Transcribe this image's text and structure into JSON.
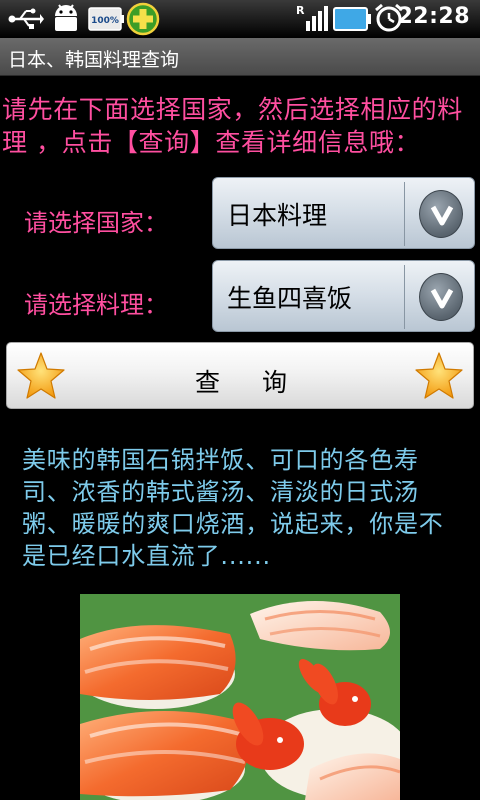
{
  "status_bar": {
    "battery_badge": "100%",
    "time": "22:28",
    "icons": [
      "usb-icon",
      "android-debug-icon",
      "battery-100-badge-icon",
      "app-plus-icon",
      "signal-icon",
      "battery-icon",
      "alarm-icon"
    ]
  },
  "app": {
    "title": "日本、韩国料理查询"
  },
  "intro_text": "请先在下面选择国家，然后选择相应的料理 ，点击【查询】查看详细信息哦：",
  "country": {
    "label": "请选择国家：",
    "value": "日本料理"
  },
  "dish": {
    "label": "请选择料理：",
    "value": "生鱼四喜饭"
  },
  "query_button": {
    "label": "查询"
  },
  "description": "美味的韩国石锅拌饭、可口的各色寿司、浓香的韩式酱汤、清淡的日式汤粥、暖暖的爽口烧酒，说起来，你是不是已经口水直流了......",
  "colors": {
    "accent_pink": "#ff4fa0",
    "desc_blue": "#7ecbeb",
    "title_bar": "#555555"
  }
}
